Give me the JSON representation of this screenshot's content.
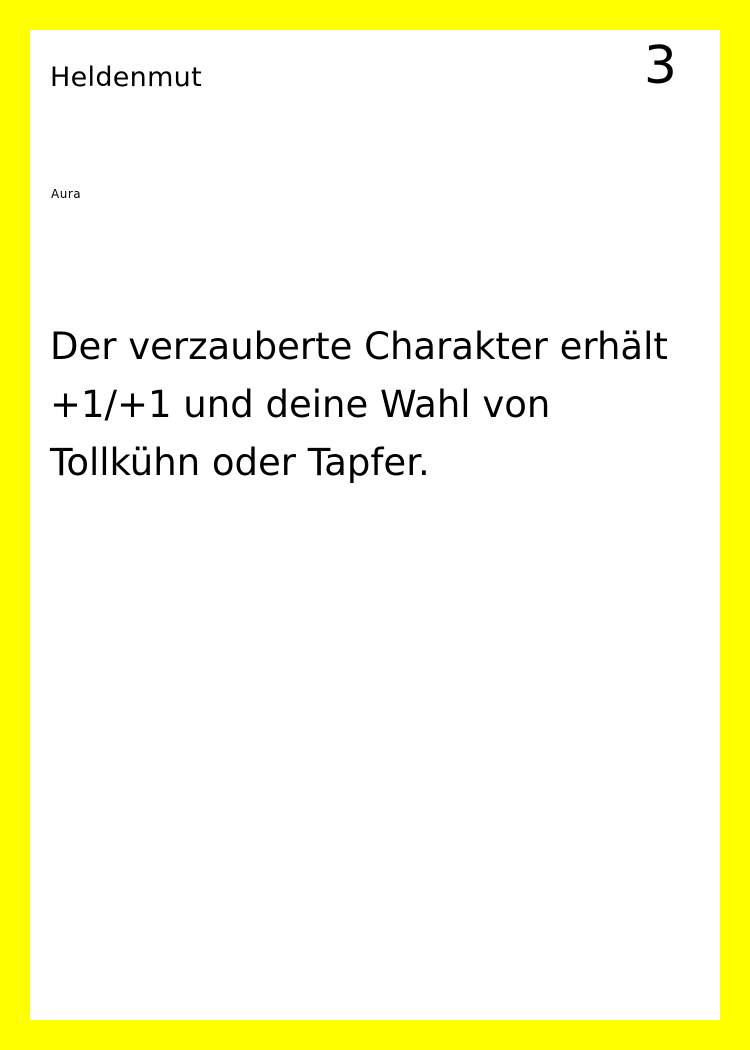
{
  "card": {
    "name": "Heldenmut",
    "cost": "3",
    "type": "Aura",
    "rules_text": "Der verzauberte Charakter erhält +1/+1 und deine Wahl von Tollkühn oder Tapfer."
  },
  "colors": {
    "border": "#ffff00",
    "card_background": "#ffffff",
    "text": "#000000"
  }
}
